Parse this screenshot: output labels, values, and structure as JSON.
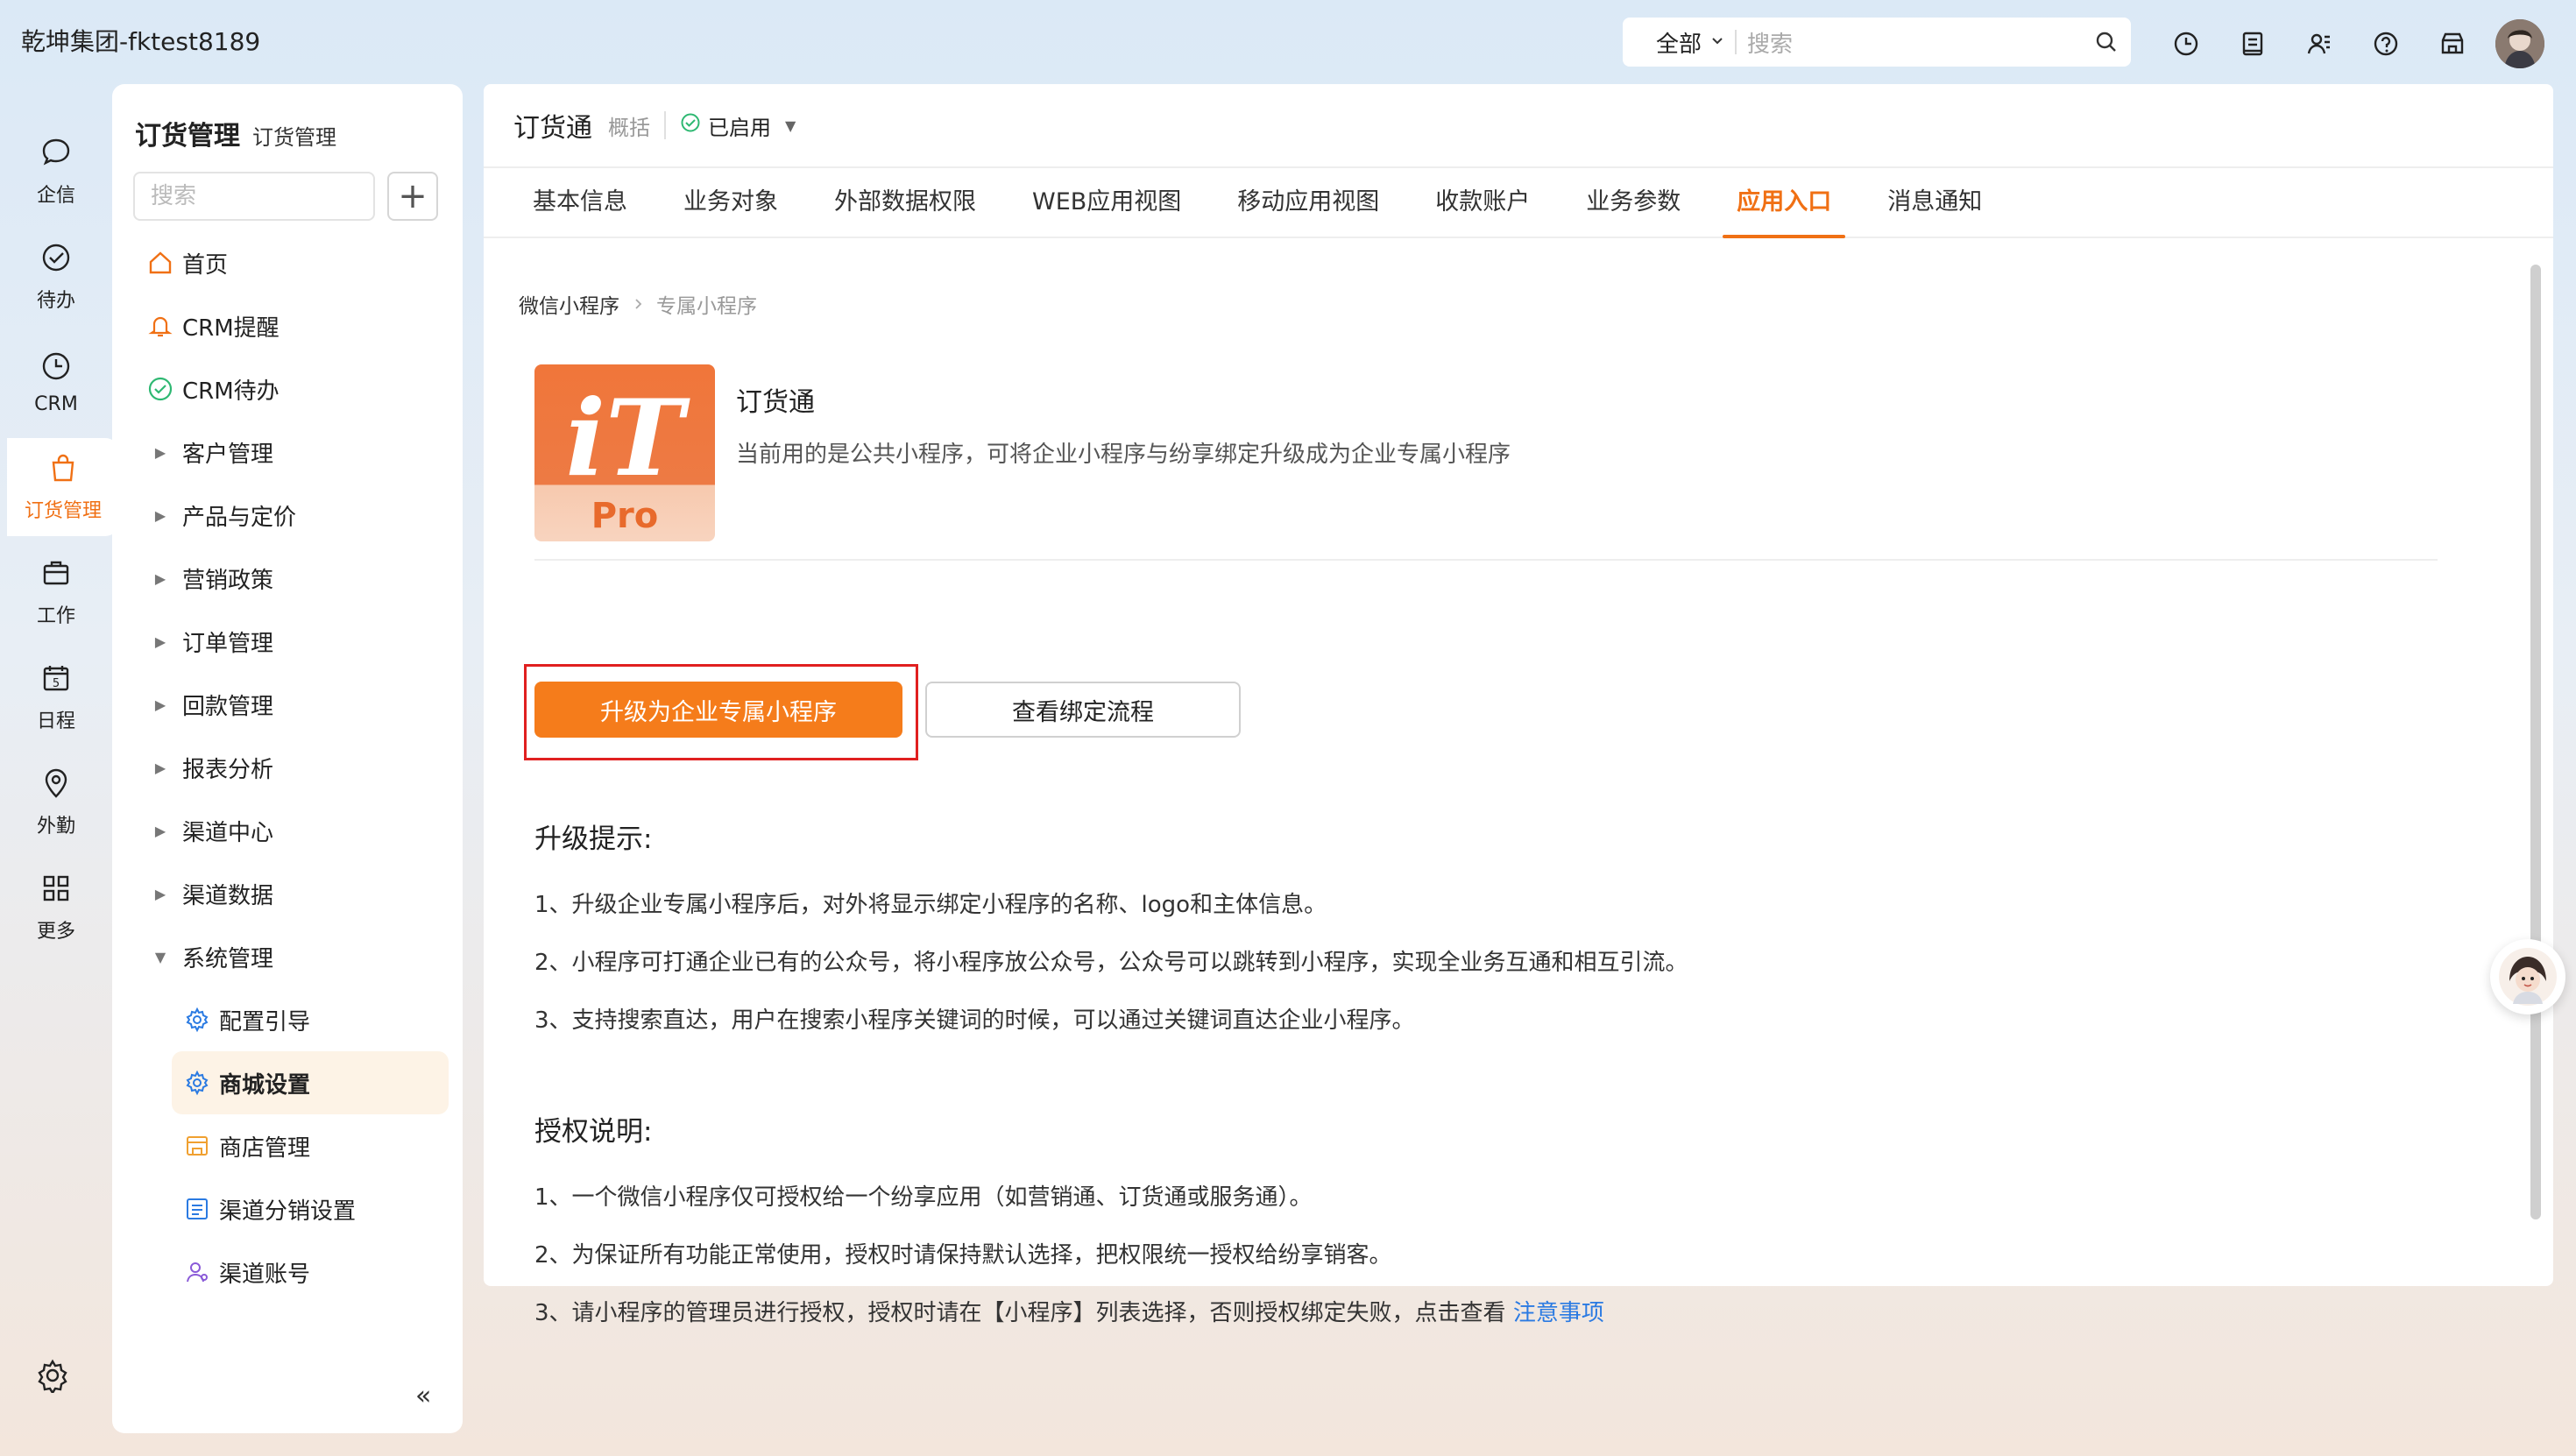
{
  "topbar": {
    "company": "乾坤集团-fktest8189",
    "search_scope": "全部",
    "search_placeholder": "搜索",
    "icons": [
      "clock-icon",
      "notebook-icon",
      "contacts-icon",
      "help-icon",
      "store-icon"
    ]
  },
  "leftnav": {
    "items": [
      {
        "label": "企信",
        "icon": "chat-icon"
      },
      {
        "label": "待办",
        "icon": "check-circle-icon"
      },
      {
        "label": "CRM",
        "icon": "clock-icon"
      },
      {
        "label": "订货管理",
        "icon": "bag-icon"
      },
      {
        "label": "工作",
        "icon": "briefcase-icon"
      },
      {
        "label": "日程",
        "icon": "calendar-icon",
        "calendar_day": "5"
      },
      {
        "label": "外勤",
        "icon": "location-icon"
      },
      {
        "label": "更多",
        "icon": "grid-icon"
      }
    ],
    "active_index": 3
  },
  "sidemenu": {
    "title": "订货管理",
    "subtitle": "订货管理",
    "search_placeholder": "搜索",
    "add_label": "+",
    "items": [
      {
        "label": "首页",
        "type": "icon",
        "icon": "home-icon"
      },
      {
        "label": "CRM提醒",
        "type": "icon",
        "icon": "bell-icon"
      },
      {
        "label": "CRM待办",
        "type": "icon",
        "icon": "check-circle-icon"
      },
      {
        "label": "客户管理",
        "type": "collapsed"
      },
      {
        "label": "产品与定价",
        "type": "collapsed"
      },
      {
        "label": "营销政策",
        "type": "collapsed"
      },
      {
        "label": "订单管理",
        "type": "collapsed"
      },
      {
        "label": "回款管理",
        "type": "collapsed"
      },
      {
        "label": "报表分析",
        "type": "collapsed"
      },
      {
        "label": "渠道中心",
        "type": "collapsed"
      },
      {
        "label": "渠道数据",
        "type": "collapsed"
      },
      {
        "label": "系统管理",
        "type": "expanded"
      }
    ],
    "subitems": [
      {
        "label": "配置引导",
        "icon": "gear-icon"
      },
      {
        "label": "商城设置",
        "icon": "gear-icon",
        "selected": true
      },
      {
        "label": "商店管理",
        "icon": "shop-icon"
      },
      {
        "label": "渠道分销设置",
        "icon": "list-icon"
      },
      {
        "label": "渠道账号",
        "icon": "users-icon"
      }
    ],
    "collapse_label": "«"
  },
  "main": {
    "title": "订货通",
    "subtitle": "概括",
    "status": "已启用",
    "tabs": [
      "基本信息",
      "业务对象",
      "外部数据权限",
      "WEB应用视图",
      "移动应用视图",
      "收款账户",
      "业务参数",
      "应用入口",
      "消息通知"
    ],
    "active_tab": 7,
    "breadcrumb": [
      "微信小程序",
      "专属小程序"
    ],
    "app": {
      "logo_main": "iT",
      "logo_sub": "Pro",
      "name": "订货通",
      "description": "当前用的是公共小程序，可将企业小程序与纷享绑定升级成为企业专属小程序"
    },
    "buttons": {
      "upgrade": "升级为企业专属小程序",
      "view_flow": "查看绑定流程"
    },
    "upgrade_tips": {
      "title": "升级提示:",
      "lines": [
        "1、升级企业专属小程序后，对外将显示绑定小程序的名称、logo和主体信息。",
        "2、小程序可打通企业已有的公众号，将小程序放公众号，公众号可以跳转到小程序，实现全业务互通和相互引流。",
        "3、支持搜索直达，用户在搜索小程序关键词的时候，可以通过关键词直达企业小程序。"
      ]
    },
    "auth_notes": {
      "title": "授权说明:",
      "lines": [
        "1、一个微信小程序仅可授权给一个纷享应用（如营销通、订货通或服务通）。",
        "2、为保证所有功能正常使用，授权时请保持默认选择，把权限统一授权给纷享销客。",
        "3、请小程序的管理员进行授权，授权时请在【小程序】列表选择，否则授权绑定失败，点击查看 "
      ],
      "link": "注意事项"
    }
  }
}
